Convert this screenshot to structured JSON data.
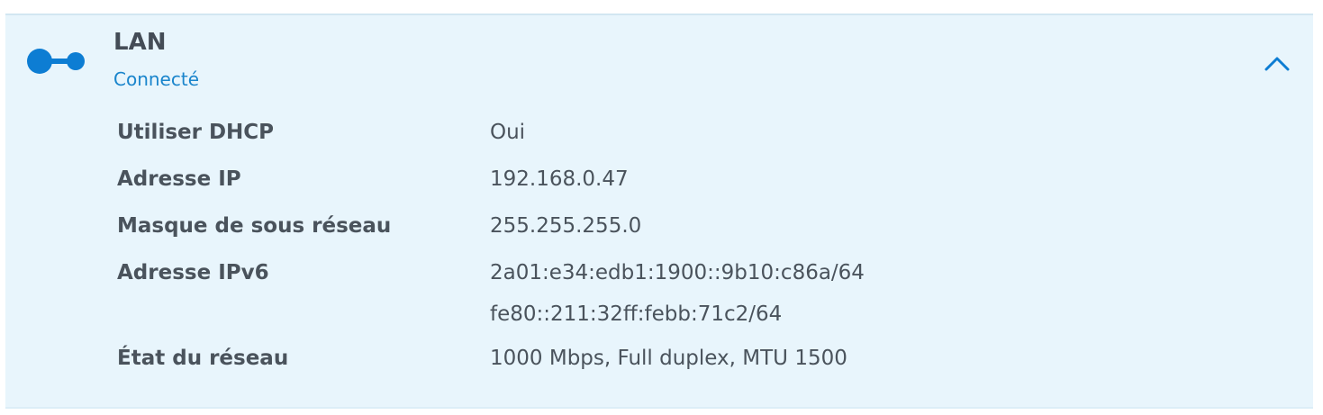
{
  "network": {
    "title": "LAN",
    "status": "Connecté",
    "icon": "connection-icon",
    "accent_color": "#0d7dd3",
    "expanded": true
  },
  "details": [
    {
      "label": "Utiliser DHCP",
      "values": [
        "Oui"
      ]
    },
    {
      "label": "Adresse IP",
      "values": [
        "192.168.0.47"
      ]
    },
    {
      "label": "Masque de sous réseau",
      "values": [
        "255.255.255.0"
      ]
    },
    {
      "label": "Adresse IPv6",
      "values": [
        "2a01:e34:edb1:1900::9b10:c86a/64",
        "fe80::211:32ff:febb:71c2/64"
      ]
    },
    {
      "label": "État du réseau",
      "values": [
        "1000 Mbps, Full duplex, MTU 1500"
      ]
    }
  ]
}
